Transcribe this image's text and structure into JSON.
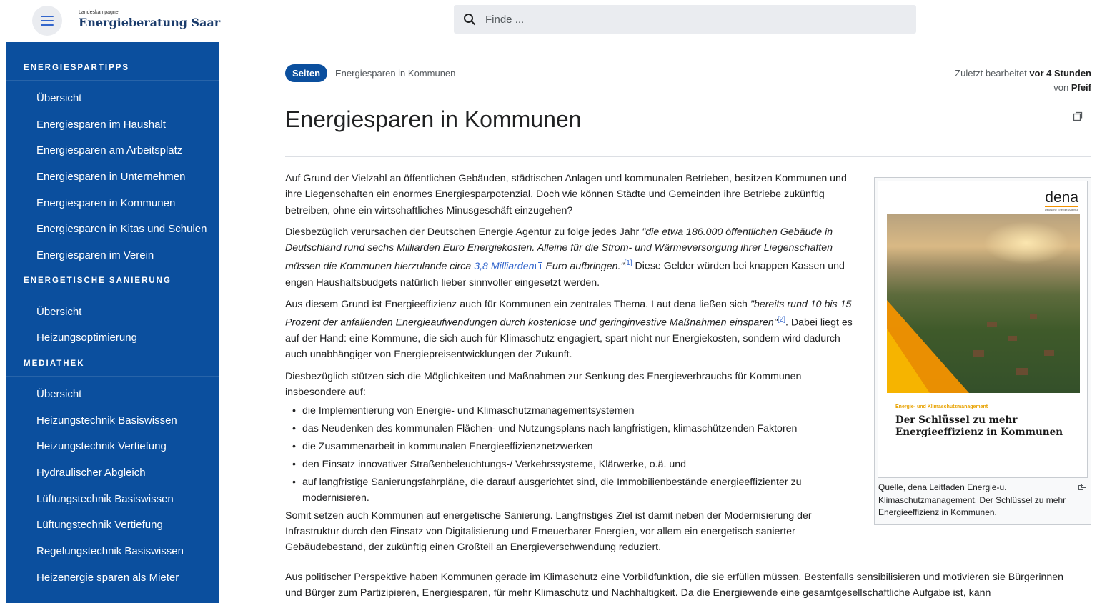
{
  "header": {
    "logo_small": "Landeskampagne",
    "logo_big": "Energieberatung Saar",
    "search_placeholder": "Finde ..."
  },
  "sidebar": {
    "sections": [
      {
        "title": "ENERGIESPARTIPPS",
        "items": [
          "Übersicht",
          "Energiesparen im Haushalt",
          "Energiesparen am Arbeitsplatz",
          "Energiesparen in Unternehmen",
          "Energiesparen in Kommunen",
          "Energiesparen in Kitas und Schulen",
          "Energiesparen im Verein"
        ]
      },
      {
        "title": "ENERGETISCHE SANIERUNG",
        "items": [
          "Übersicht",
          "Heizungsoptimierung"
        ]
      },
      {
        "title": "MEDIATHEK",
        "items": [
          "Übersicht",
          "Heizungstechnik Basiswissen",
          "Heizungstechnik Vertiefung",
          "Hydraulischer Abgleich",
          "Lüftungstechnik Basiswissen",
          "Lüftungstechnik Vertiefung",
          "Regelungstechnik Basiswissen",
          "Heizenergie sparen als Mieter"
        ]
      }
    ]
  },
  "main": {
    "badge": "Seiten",
    "breadcrumb": "Energiesparen in Kommunen",
    "edited_prefix": "Zuletzt bearbeitet",
    "edited_time": "vor 4 Stunden",
    "edited_by_prefix": "von",
    "edited_by": "Pfeif",
    "title": "Energiesparen in Kommunen",
    "p1": "Auf Grund der Vielzahl an öffentlichen Gebäuden, städtischen Anlagen und kommunalen Betrieben, besitzen Kommunen und ihre Liegenschaften ein enormes Energiesparpotenzial. Doch wie können Städte und Gemeinden ihre Betriebe zukünftig betreiben, ohne ein wirtschaftliches Minusgeschäft einzugehen?",
    "p2_a": "Diesbezüglich verursachen der Deutschen Energie Agentur zu folge jedes Jahr ",
    "p2_quote": "\"die etwa 186.000 öffentlichen Gebäude in Deutschland rund sechs Milliarden Euro Energiekosten. Alleine für die Strom- und Wärmeversorgung ihrer Liegenschaften müssen die Kommunen hierzulande circa ",
    "p2_link": "3,8 Milliarden",
    "p2_quote_end": " Euro aufbringen.\"",
    "p2_ref": "[1]",
    "p2_b": " Diese Gelder würden bei knappen Kassen und engen Haushaltsbudgets natürlich lieber sinnvoller eingesetzt werden.",
    "p3_a": "Aus diesem Grund ist Energieeffizienz auch für Kommunen ein zentrales Thema. Laut dena ließen sich ",
    "p3_quote": "\"bereits rund 10 bis 15 Prozent der anfallenden Energieaufwendungen durch kostenlose und geringinvestive Maßnahmen einsparen\"",
    "p3_ref": "[2]",
    "p3_b": ". Dabei liegt es auf der Hand: eine Kommune, die sich auch für Klimaschutz engagiert, spart nicht nur Energiekosten, sondern wird dadurch auch unabhängiger von Energiepreisentwicklungen der Zukunft.",
    "p4": "Diesbezüglich stützen sich die Möglichkeiten und Maßnahmen zur Senkung des Energieverbrauchs für Kommunen insbesondere auf:",
    "bullets": [
      "die Implementierung von Energie- und Klimaschutzmanagementsystemen",
      "das Neudenken des kommunalen Flächen- und Nutzungsplans nach langfristigen, klimaschützenden Faktoren",
      "die Zusammenarbeit in kommunalen Energieeffizienznetzwerken",
      "den Einsatz innovativer Straßenbeleuchtungs-/ Verkehrssysteme, Klärwerke, o.ä. und",
      "auf langfristige Sanierungsfahrpläne, die darauf ausgerichtet sind, die Immobilienbestände energieeffizienter zu modernisieren."
    ],
    "p5": "Somit setzen auch Kommunen auf energetische Sanierung. Langfristiges Ziel ist damit neben der Modernisierung der Infrastruktur durch den Einsatz von Digitalisierung und Erneuerbarer Energien, vor allem ein energetisch sanierter Gebäudebestand, der zukünftig einen Großteil an Energieverschwendung reduziert.",
    "p6": "Aus politischer Perspektive haben Kommunen gerade im Klimaschutz eine Vorbildfunktion, die sie erfüllen müssen. Bestenfalls sensibilisieren und motivieren sie Bürgerinnen und Bürger zum Partizipieren, Energiesparen, für mehr Klimaschutz und Nachhaltigkeit. Da die Energiewende eine gesamtgesellschaftliche Aufgabe ist, kann"
  },
  "figure": {
    "logo": "dena",
    "logo_sub": "Deutsche Energie-Agentur",
    "cover_sub": "Energie- und Klimaschutzmanagement",
    "cover_title_1": "Der Schlüssel zu mehr",
    "cover_title_2": "Energieeffizienz in Kommunen",
    "caption": "Quelle, dena Leitfaden Energie-u. Klimaschutzmanagement. Der Schlüssel zu mehr Energieeffizienz in Kommunen."
  },
  "colors": {
    "sidebar_bg": "#0b4f9e",
    "link": "#3366cc",
    "accent_orange": "#f39200"
  }
}
